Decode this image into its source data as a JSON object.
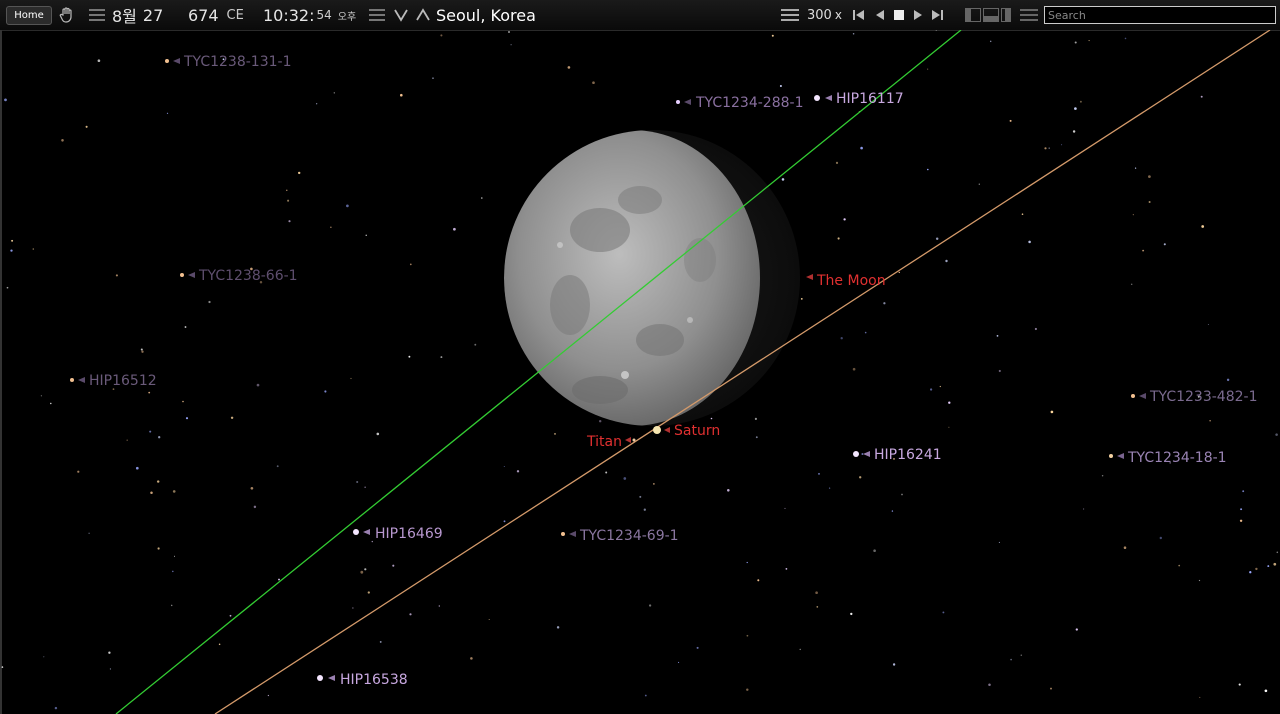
{
  "toolbar": {
    "home_label": "Home",
    "date_month": "8월",
    "date_day": "27",
    "year": "674",
    "era": "CE",
    "time_hm": "10:32:",
    "time_s": "54",
    "ampm": "오후",
    "location": "Seoul, Korea",
    "speed": "300",
    "speed_unit": "x",
    "search_placeholder": "Search"
  },
  "sky": {
    "moon_label": "The Moon",
    "saturn_label": "Saturn",
    "titan_label": "Titan",
    "colors": {
      "green_line": "#33cc33",
      "ecliptic": "#d49a6a",
      "planet_label": "#e03030",
      "bright_star_label": "#c8a8e0",
      "dim_star_label": "#6a5a7a"
    },
    "stars": [
      {
        "name": "TYC1238-131-1",
        "bright": false
      },
      {
        "name": "TYC1234-288-1",
        "bright": false
      },
      {
        "name": "HIP16117",
        "bright": true
      },
      {
        "name": "TYC1238-66-1",
        "bright": false
      },
      {
        "name": "HIP16512",
        "bright": false
      },
      {
        "name": "TYC1233-482-1",
        "bright": false
      },
      {
        "name": "HIP16241",
        "bright": true
      },
      {
        "name": "TYC1234-18-1",
        "bright": false
      },
      {
        "name": "HIP16469",
        "bright": true
      },
      {
        "name": "TYC1234-69-1",
        "bright": false
      },
      {
        "name": "HIP16538",
        "bright": true
      }
    ]
  }
}
